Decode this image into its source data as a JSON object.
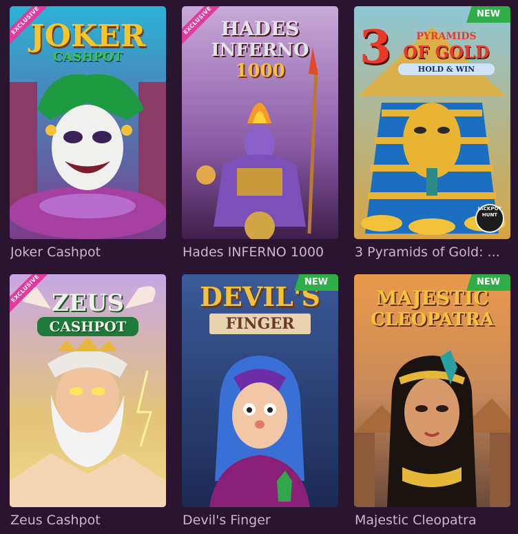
{
  "games": [
    {
      "title": "Joker Cashpot",
      "logo_top": "JOKER",
      "logo_bottom": "CASHPOT",
      "badge": "EXCLUSIVE"
    },
    {
      "title": "Hades INFERNO 1000",
      "logo_top": "HADES",
      "logo_mid": "INFERNO",
      "logo_bottom": "1000",
      "badge": "EXCLUSIVE"
    },
    {
      "title": "3 Pyramids of Gold: ...",
      "logo_top": "PYRAMIDS",
      "logo_mid": "OF GOLD",
      "logo_bottom": "HOLD & WIN",
      "badge": "NEW",
      "extra": "JACKPOT HUNT"
    },
    {
      "title": "Zeus Cashpot",
      "logo_top": "ZEUS",
      "logo_bottom": "CASHPOT",
      "badge": "EXCLUSIVE"
    },
    {
      "title": "Devil's Finger",
      "logo_top": "DEVIL'S",
      "logo_bottom": "FINGER",
      "badge": "NEW"
    },
    {
      "title": "Majestic Cleopatra",
      "logo_top": "MAJESTIC",
      "logo_bottom": "CLEOPATRA",
      "badge": "NEW"
    }
  ],
  "three_digit": "3"
}
